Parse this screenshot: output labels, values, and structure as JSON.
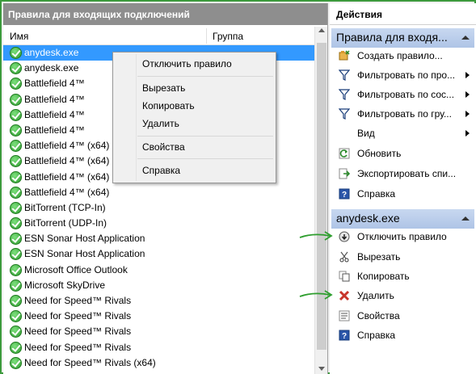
{
  "left_pane": {
    "title": "Правила для входящих подключений",
    "columns": {
      "name": "Имя",
      "group": "Группа"
    },
    "rows": [
      {
        "name": "anydesk.exe",
        "selected": true
      },
      {
        "name": "anydesk.exe"
      },
      {
        "name": "Battlefield 4™"
      },
      {
        "name": "Battlefield 4™"
      },
      {
        "name": "Battlefield 4™"
      },
      {
        "name": "Battlefield 4™"
      },
      {
        "name": "Battlefield 4™ (x64)"
      },
      {
        "name": "Battlefield 4™ (x64)"
      },
      {
        "name": "Battlefield 4™ (x64)"
      },
      {
        "name": "Battlefield 4™ (x64)"
      },
      {
        "name": "BitTorrent (TCP-In)"
      },
      {
        "name": "BitTorrent (UDP-In)"
      },
      {
        "name": "ESN Sonar Host Application"
      },
      {
        "name": "ESN Sonar Host Application"
      },
      {
        "name": "Microsoft Office Outlook"
      },
      {
        "name": "Microsoft SkyDrive"
      },
      {
        "name": "Need for Speed™ Rivals"
      },
      {
        "name": "Need for Speed™ Rivals"
      },
      {
        "name": "Need for Speed™ Rivals"
      },
      {
        "name": "Need for Speed™ Rivals"
      },
      {
        "name": "Need for Speed™ Rivals (x64)"
      }
    ]
  },
  "context_menu": {
    "disable_rule": "Отключить правило",
    "cut": "Вырезать",
    "copy": "Копировать",
    "delete": "Удалить",
    "properties": "Свойства",
    "help": "Справка"
  },
  "actions_pane": {
    "title": "Действия",
    "section1": {
      "title": "Правила для входя...",
      "items": {
        "new_rule": "Создать правило...",
        "filter_profile": "Фильтровать по про...",
        "filter_state": "Фильтровать по сос...",
        "filter_group": "Фильтровать по гру...",
        "view": "Вид",
        "refresh": "Обновить",
        "export": "Экспортировать спи...",
        "help": "Справка"
      }
    },
    "section2": {
      "title": "anydesk.exe",
      "items": {
        "disable_rule": "Отключить правило",
        "cut": "Вырезать",
        "copy": "Копировать",
        "delete": "Удалить",
        "properties": "Свойства",
        "help": "Справка"
      }
    }
  },
  "colors": {
    "frame_border": "#3c9a3c",
    "title_bar": "#8e8e8e",
    "selection": "#3399ff",
    "section_header": "#aec4e6",
    "annotation_arrow": "#2e9e2e"
  }
}
